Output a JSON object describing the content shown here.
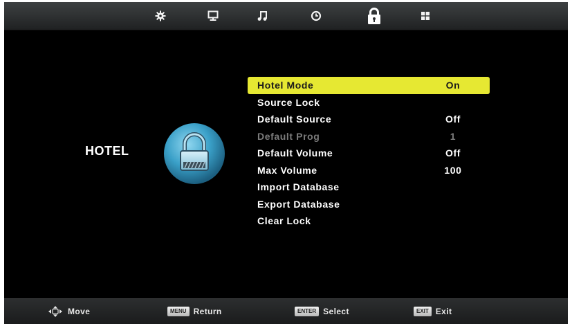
{
  "tabs": [
    {
      "icon": "gear-icon",
      "name": "picture-settings"
    },
    {
      "icon": "monitor-icon",
      "name": "screen"
    },
    {
      "icon": "music-note-icon",
      "name": "sound"
    },
    {
      "icon": "clock-icon",
      "name": "time"
    },
    {
      "icon": "lock-icon",
      "name": "lock",
      "active": true
    },
    {
      "icon": "grid-icon",
      "name": "setup"
    }
  ],
  "section": {
    "title": "HOTEL",
    "icon": "padlock-badge-icon"
  },
  "menu": {
    "items": [
      {
        "label": "Hotel Mode",
        "value": "On",
        "selected": true
      },
      {
        "label": "Source Lock",
        "value": ""
      },
      {
        "label": "Default Source",
        "value": "Off"
      },
      {
        "label": "Default Prog",
        "value": "1",
        "disabled": true
      },
      {
        "label": "Default Volume",
        "value": "Off"
      },
      {
        "label": "Max Volume",
        "value": "100"
      },
      {
        "label": "Import Database",
        "value": ""
      },
      {
        "label": "Export Database",
        "value": ""
      },
      {
        "label": "Clear Lock",
        "value": ""
      }
    ]
  },
  "footer": {
    "move": {
      "label": "Move"
    },
    "return": {
      "key": "MENU",
      "label": "Return"
    },
    "select": {
      "key": "ENTER",
      "label": "Select"
    },
    "exit": {
      "key": "EXIT",
      "label": "Exit"
    }
  },
  "colors": {
    "highlight": "#e6e832",
    "background": "#000000",
    "disabled_text": "#7b7b7b",
    "badge": "#3aa0c8"
  }
}
